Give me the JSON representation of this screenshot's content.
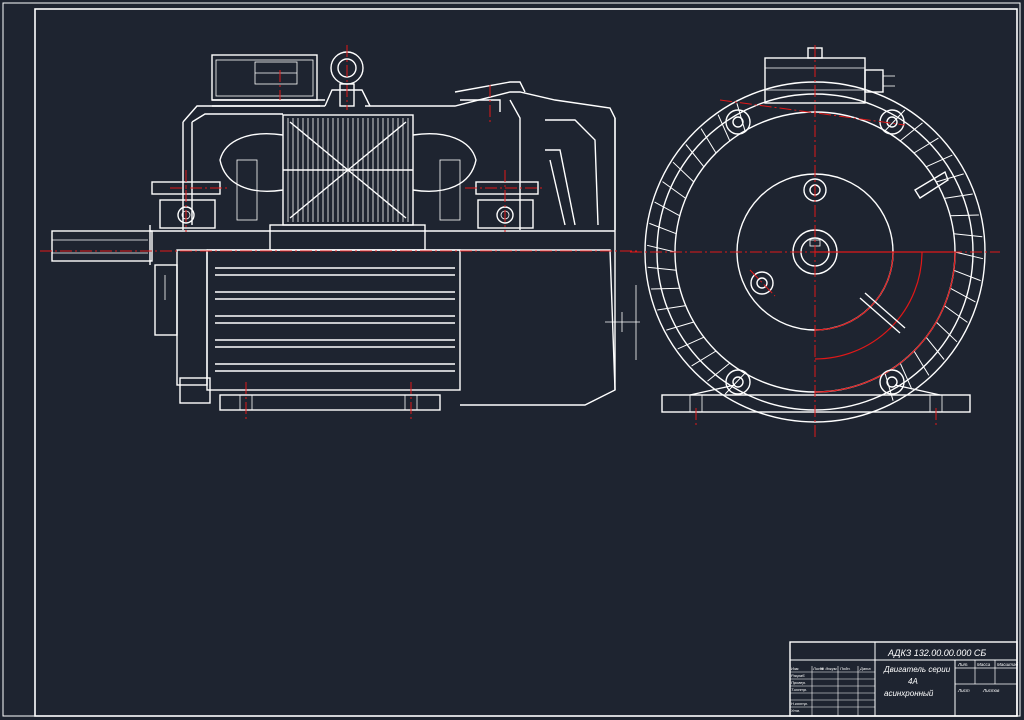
{
  "title_block": {
    "designation": "АДКЗ 132.00.00.000 СБ",
    "name_line1": "Двигатель серии",
    "name_line2": "4А",
    "name_line3": "асинхронный",
    "col_lit": "Лит.",
    "col_mass": "Масса",
    "col_scale": "Масштаб",
    "sheet": "Лист",
    "sheets": "Листов",
    "role_dev": "Разраб.",
    "role_check": "Провер.",
    "role_tcontrol": "Т.контр.",
    "role_ncontrol": "Н.контр.",
    "role_approve": "Утв.",
    "hdr_change": "Изм.",
    "hdr_sheet": "Лист",
    "hdr_doc": "№ докум.",
    "hdr_sign": "Подп.",
    "hdr_date": "Дата"
  },
  "colors": {
    "background": "#1e2430",
    "lines": "#ffffff",
    "centerlines": "#e01818"
  }
}
